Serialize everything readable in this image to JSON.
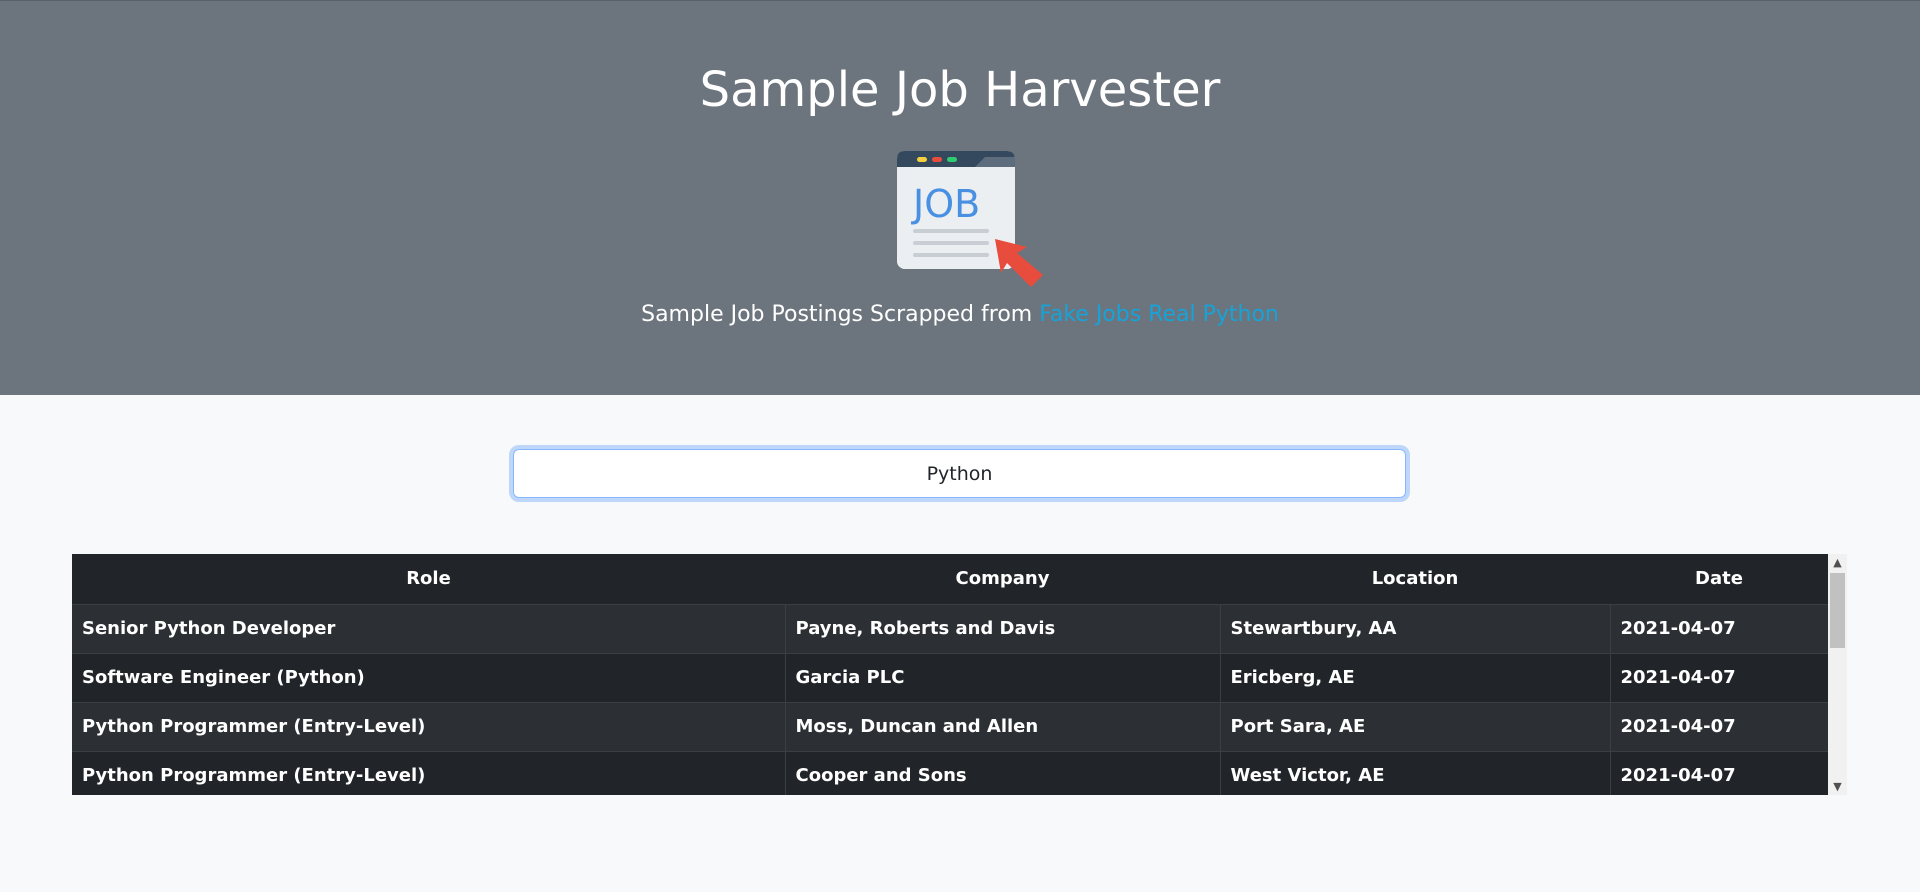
{
  "header": {
    "title": "Sample Job Harvester",
    "logo_text": "JOB",
    "subtitle_prefix": "Sample Job Postings Scrapped from",
    "subtitle_link": "Fake Jobs Real Python"
  },
  "search": {
    "value": "Python"
  },
  "table": {
    "columns": [
      "Role",
      "Company",
      "Location",
      "Date"
    ],
    "rows": [
      {
        "role": "Senior Python Developer",
        "company": "Payne, Roberts and Davis",
        "location": "Stewartbury, AA",
        "date": "2021-04-07"
      },
      {
        "role": "Software Engineer (Python)",
        "company": "Garcia PLC",
        "location": "Ericberg, AE",
        "date": "2021-04-07"
      },
      {
        "role": "Python Programmer (Entry-Level)",
        "company": "Moss, Duncan and Allen",
        "location": "Port Sara, AE",
        "date": "2021-04-07"
      },
      {
        "role": "Python Programmer (Entry-Level)",
        "company": "Cooper and Sons",
        "location": "West Victor, AE",
        "date": "2021-04-07"
      }
    ]
  },
  "colors": {
    "header_bg": "#6c757d",
    "link": "#17a2d8",
    "table_dark": "#212529"
  }
}
